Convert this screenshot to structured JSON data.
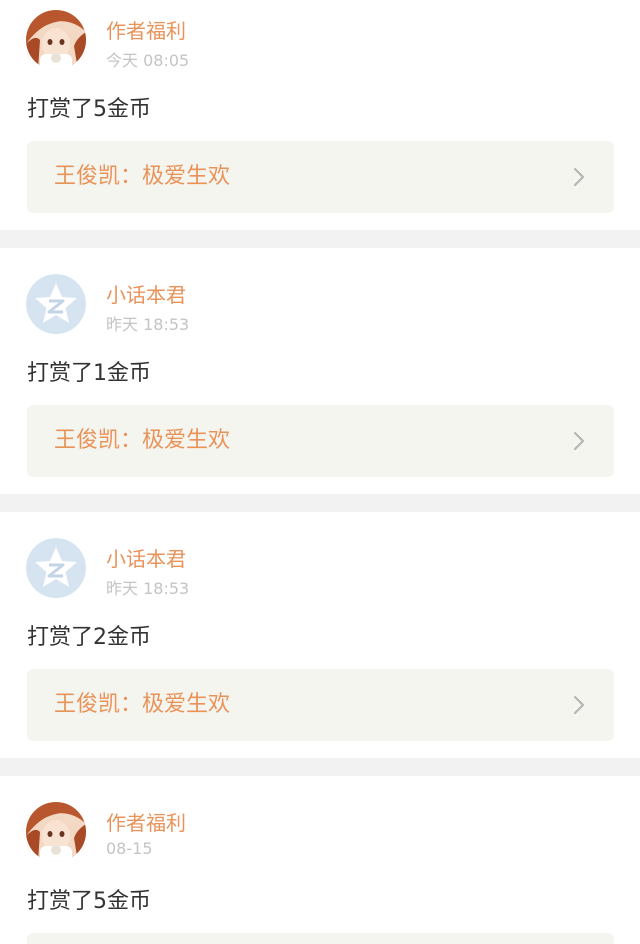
{
  "feed": [
    {
      "avatar": "anime-girl-avatar",
      "user": "作者福利",
      "time": "今天 08:05",
      "action": "打赏了5金币",
      "work_title": "王俊凯：极爱生欢"
    },
    {
      "avatar": "qzone-star-avatar",
      "user": "小话本君",
      "time": "昨天 18:53",
      "action": "打赏了1金币",
      "work_title": "王俊凯：极爱生欢"
    },
    {
      "avatar": "qzone-star-avatar",
      "user": "小话本君",
      "time": "昨天 18:53",
      "action": "打赏了2金币",
      "work_title": "王俊凯：极爱生欢"
    },
    {
      "avatar": "anime-girl-avatar",
      "user": "作者福利",
      "time": "08-15",
      "action": "打赏了5金币"
    }
  ],
  "colors": {
    "accent": "#e8935a",
    "work_bg": "#f5f5f0",
    "separator": "#f2f2f2",
    "time_text": "#c4c4c4",
    "action_text": "#333333"
  }
}
